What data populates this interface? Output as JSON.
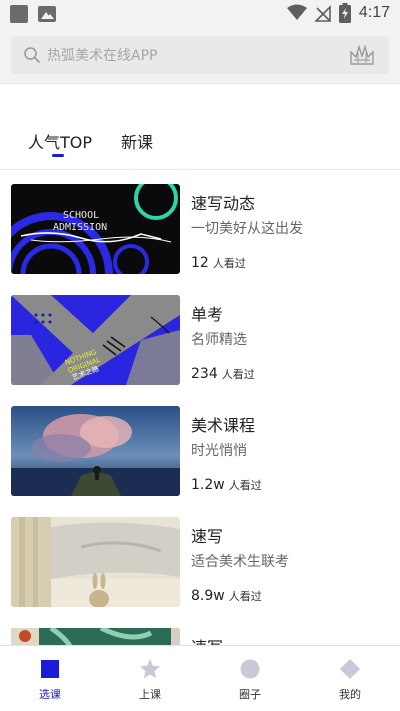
{
  "status_bar": {
    "time": "4:17"
  },
  "search": {
    "placeholder": "热弧美术在线APP"
  },
  "tabs": [
    {
      "label": "人气TOP",
      "active": true
    },
    {
      "label": "新课",
      "active": false
    }
  ],
  "courses": [
    {
      "title": "速写动态",
      "subtitle": "一切美好从这出发",
      "views": "12",
      "views_suffix": "人看过",
      "thumb_text": [
        "SCHOOL",
        "ADMISSION"
      ]
    },
    {
      "title": "单考",
      "subtitle": "名师精选",
      "views": "234",
      "views_suffix": "人看过",
      "thumb_text": [
        "NOTHING",
        "ORIGINAL",
        "艺术之路"
      ]
    },
    {
      "title": "美术课程",
      "subtitle": "时光悄悄",
      "views": "1.2w",
      "views_suffix": "人看过"
    },
    {
      "title": "速写",
      "subtitle": "适合美术生联考",
      "views": "8.9w",
      "views_suffix": "人看过"
    },
    {
      "title": "速写",
      "subtitle": "",
      "views": "",
      "views_suffix": ""
    }
  ],
  "bottom_nav": [
    {
      "label": "选课",
      "icon": "square-icon",
      "active": true
    },
    {
      "label": "上课",
      "icon": "star-icon",
      "active": false
    },
    {
      "label": "圈子",
      "icon": "circle-icon",
      "active": false
    },
    {
      "label": "我的",
      "icon": "diamond-icon",
      "active": false
    }
  ],
  "colors": {
    "accent": "#1b1bd8",
    "inactive_icon": "#c8c8d8",
    "background": "#ffffff"
  }
}
